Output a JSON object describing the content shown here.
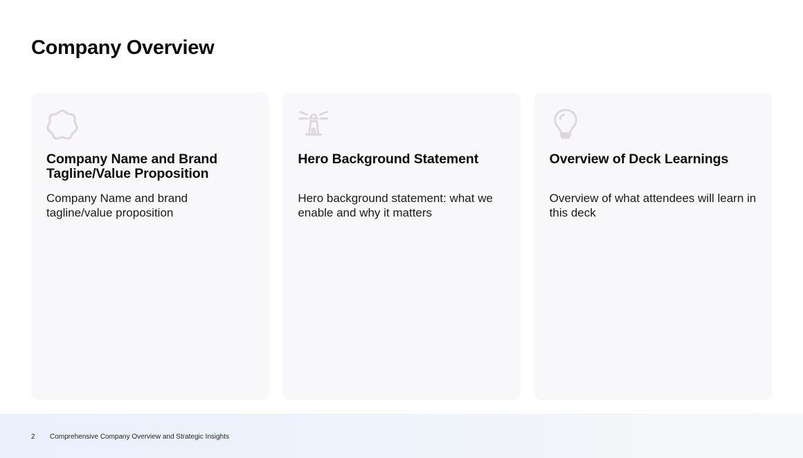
{
  "slide": {
    "title": "Company Overview"
  },
  "cards": [
    {
      "icon": "flower-badge-icon",
      "title": "Company Name and Brand Tagline/Value Proposition",
      "body": "Company Name and brand tagline/value proposition"
    },
    {
      "icon": "lighthouse-icon",
      "title": "Hero Background Statement",
      "body": "Hero background statement: what we enable and why it matters"
    },
    {
      "icon": "lightbulb-icon",
      "title": "Overview of Deck Learnings",
      "body": "Overview of what attendees will learn in this deck"
    }
  ],
  "footer": {
    "page_number": "2",
    "text": "Comprehensive Company Overview and Strategic Insights"
  },
  "colors": {
    "icon": "#ddd6dc",
    "card_background": "#f8f8fa",
    "footer_gradient_start": "#eaf1fd"
  }
}
